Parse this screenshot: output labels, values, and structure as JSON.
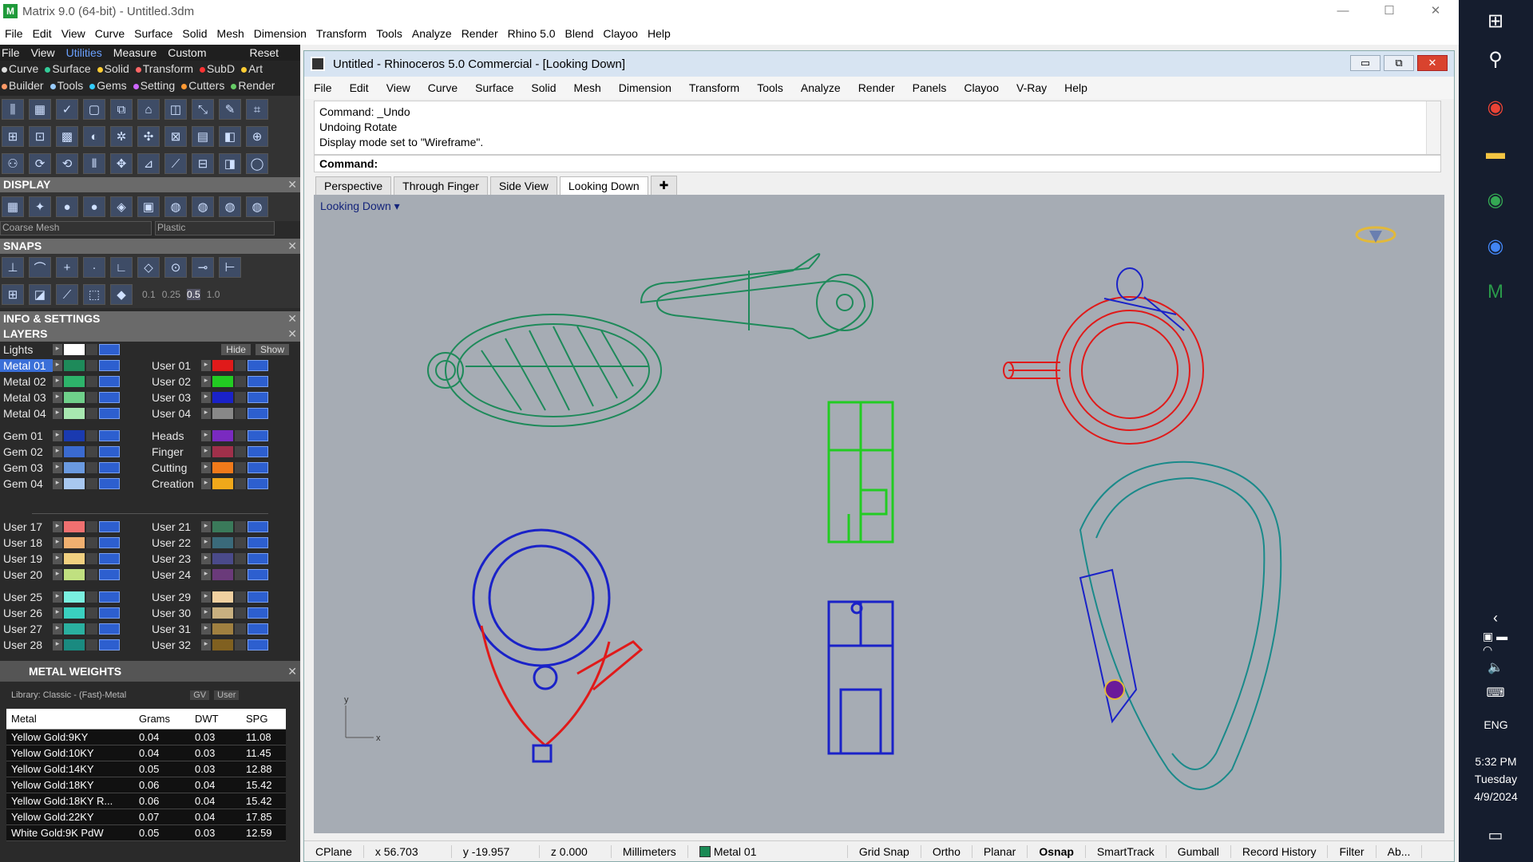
{
  "app_title": "Matrix 9.0 (64-bit) - Untitled.3dm",
  "outer_menu": [
    "File",
    "Edit",
    "View",
    "Curve",
    "Surface",
    "Solid",
    "Mesh",
    "Dimension",
    "Transform",
    "Tools",
    "Analyze",
    "Render",
    "Rhino 5.0",
    "Blend",
    "Clayoo",
    "Help"
  ],
  "left": {
    "top_menu": [
      "File",
      "View",
      "Utilities",
      "Measure",
      "Custom",
      "Reset"
    ],
    "cats_row1": [
      "Curve",
      "Surface",
      "Solid",
      "Transform",
      "SubD",
      "Art"
    ],
    "cats_row2": [
      "Builder",
      "Tools",
      "Gems",
      "Setting",
      "Cutters",
      "Render"
    ],
    "display_title": "DISPLAY",
    "mesh_select": "Coarse Mesh",
    "material_select": "Plastic",
    "snaps_title": "SNAPS",
    "snap_values": [
      "0.1",
      "0.25",
      "0.5",
      "1.0"
    ],
    "info_title": "INFO & SETTINGS",
    "layers_title": "LAYERS",
    "lights_label": "Lights",
    "hide_label": "Hide",
    "show_label": "Show",
    "layers_group1": [
      [
        "Metal 01",
        "User 01"
      ],
      [
        "Metal 02",
        "User 02"
      ],
      [
        "Metal 03",
        "User 03"
      ],
      [
        "Metal 04",
        "User 04"
      ]
    ],
    "layers_group2": [
      [
        "Gem 01",
        "Heads"
      ],
      [
        "Gem 02",
        "Finger"
      ],
      [
        "Gem 03",
        "Cutting"
      ],
      [
        "Gem 04",
        "Creation"
      ]
    ],
    "layers_group3": [
      [
        "User 17",
        "User 21"
      ],
      [
        "User 18",
        "User 22"
      ],
      [
        "User 19",
        "User 23"
      ],
      [
        "User 20",
        "User 24"
      ]
    ],
    "layers_group4": [
      [
        "User 25",
        "User 29"
      ],
      [
        "User 26",
        "User 30"
      ],
      [
        "User 27",
        "User 31"
      ],
      [
        "User 28",
        "User 32"
      ]
    ],
    "metal_weights_title": "METAL WEIGHTS",
    "library_label": "Library: Classic - (Fast)-Metal",
    "gv_label": "GV",
    "user_label": "User",
    "metal_headers": [
      "Metal",
      "Grams",
      "DWT",
      "SPG"
    ],
    "metal_rows": [
      [
        "Yellow Gold:9KY",
        "0.04",
        "0.03",
        "11.08"
      ],
      [
        "Yellow Gold:10KY",
        "0.04",
        "0.03",
        "11.45"
      ],
      [
        "Yellow Gold:14KY",
        "0.05",
        "0.03",
        "12.88"
      ],
      [
        "Yellow Gold:18KY",
        "0.06",
        "0.04",
        "15.42"
      ],
      [
        "Yellow Gold:18KY R...",
        "0.06",
        "0.04",
        "15.42"
      ],
      [
        "Yellow Gold:22KY",
        "0.07",
        "0.04",
        "17.85"
      ],
      [
        "White Gold:9K PdW",
        "0.05",
        "0.03",
        "12.59"
      ]
    ]
  },
  "rhino": {
    "title": "Untitled - Rhinoceros 5.0 Commercial - [Looking Down]",
    "menu": [
      "File",
      "Edit",
      "View",
      "Curve",
      "Surface",
      "Solid",
      "Mesh",
      "Dimension",
      "Transform",
      "Tools",
      "Analyze",
      "Render",
      "Panels",
      "Clayoo",
      "V-Ray",
      "Help"
    ],
    "cmd_history": [
      "Command: _Undo",
      "Undoing Rotate",
      "Display mode set to \"Wireframe\"."
    ],
    "cmd_prompt": "Command:",
    "tabs": [
      "Perspective",
      "Through Finger",
      "Side View",
      "Looking Down"
    ],
    "active_tab": "Looking Down",
    "viewport_label": "Looking Down",
    "axis_x": "x",
    "axis_y": "y",
    "status": {
      "cplane": "CPlane",
      "x": "x 56.703",
      "y": "y -19.957",
      "z": "z 0.000",
      "units": "Millimeters",
      "layer": "Metal 01",
      "toggles": [
        "Grid Snap",
        "Ortho",
        "Planar",
        "Osnap",
        "SmartTrack",
        "Gumball",
        "Record History",
        "Filter",
        "Ab..."
      ],
      "bold_toggle": "Osnap"
    }
  },
  "taskbar": {
    "lang": "ENG",
    "time": "5:32 PM",
    "day": "Tuesday",
    "date": "4/9/2024"
  },
  "colors": {
    "viewport_bg": "#a6acb4",
    "green_part": "#1e8a5a",
    "red_part": "#e01a1a",
    "blue_part": "#1a22c8",
    "teal_part": "#1a8a8a",
    "lime_part": "#22cc22"
  }
}
